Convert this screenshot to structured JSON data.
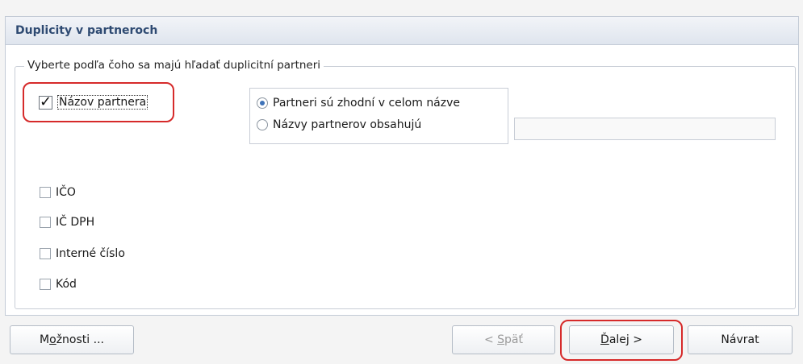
{
  "window": {
    "title": "Duplicity v partneroch"
  },
  "group": {
    "legend": "Vyberte podľa čoho sa majú hľadať duplicitní partneri"
  },
  "criteria": {
    "name": {
      "label": "Názov partnera",
      "checked": true
    },
    "ico": {
      "label": "IČO",
      "checked": false
    },
    "icdph": {
      "label": "IČ DPH",
      "checked": false
    },
    "internal": {
      "label": "Interné číslo",
      "checked": false
    },
    "code": {
      "label": "Kód",
      "checked": false
    }
  },
  "match_mode": {
    "options": [
      {
        "label": "Partneri sú zhodní v celom názve",
        "selected": true
      },
      {
        "label": "Názvy partnerov obsahujú",
        "selected": false
      }
    ],
    "contains_value": ""
  },
  "buttons": {
    "options": {
      "prefix": "M",
      "underline": "o",
      "suffix": "žnosti ..."
    },
    "back": {
      "prefix": "< ",
      "underline": "S",
      "suffix": "päť"
    },
    "next": {
      "prefix": "",
      "underline": "Ď",
      "suffix": "alej >"
    },
    "cancel": "Návrat"
  },
  "colors": {
    "title": "#2e4a72",
    "highlight": "#d62a2a",
    "radio_dot": "#3f73b8"
  }
}
